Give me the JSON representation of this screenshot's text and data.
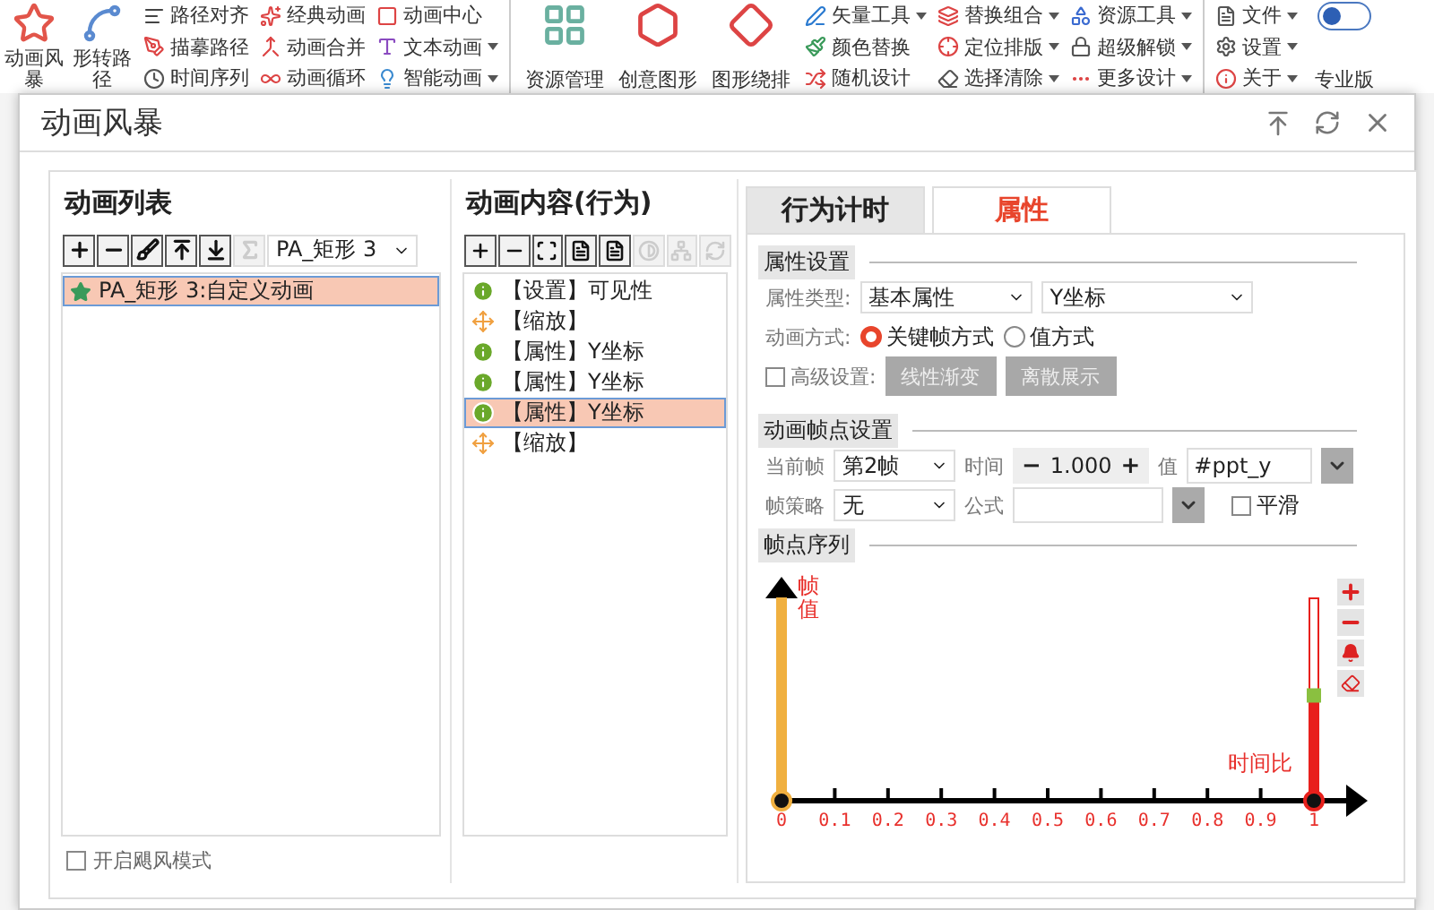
{
  "ribbon": {
    "groups": [
      {
        "items": [
          {
            "label": "动画风暴",
            "kind": "large"
          },
          {
            "label": "形转路径",
            "kind": "large"
          }
        ]
      },
      {
        "items": [
          {
            "label": "路径对齐",
            "kind": "small"
          },
          {
            "label": "描摹路径",
            "kind": "small"
          },
          {
            "label": "时间序列",
            "kind": "small"
          }
        ]
      },
      {
        "items": [
          {
            "label": "经典动画",
            "kind": "small"
          },
          {
            "label": "动画合并",
            "kind": "small"
          },
          {
            "label": "动画循环",
            "kind": "small"
          }
        ]
      },
      {
        "items": [
          {
            "label": "动画中心",
            "kind": "small"
          },
          {
            "label": "文本动画",
            "kind": "small",
            "dropdown": true
          },
          {
            "label": "智能动画",
            "kind": "small",
            "dropdown": true
          }
        ]
      },
      {
        "items": [
          {
            "label": "资源管理",
            "kind": "large"
          },
          {
            "label": "创意图形",
            "kind": "large"
          },
          {
            "label": "图形绕排",
            "kind": "large"
          }
        ]
      },
      {
        "items": [
          {
            "label": "矢量工具",
            "kind": "small",
            "dropdown": true
          },
          {
            "label": "颜色替换",
            "kind": "small"
          },
          {
            "label": "随机设计",
            "kind": "small"
          }
        ]
      },
      {
        "items": [
          {
            "label": "替换组合",
            "kind": "small",
            "dropdown": true
          },
          {
            "label": "定位排版",
            "kind": "small",
            "dropdown": true
          },
          {
            "label": "选择清除",
            "kind": "small",
            "dropdown": true
          }
        ]
      },
      {
        "items": [
          {
            "label": "资源工具",
            "kind": "small",
            "dropdown": true
          },
          {
            "label": "超级解锁",
            "kind": "small",
            "dropdown": true
          },
          {
            "label": "更多设计",
            "kind": "small",
            "dropdown": true
          }
        ]
      },
      {
        "items": [
          {
            "label": "文件",
            "kind": "small",
            "dropdown": true
          },
          {
            "label": "设置",
            "kind": "small",
            "dropdown": true
          },
          {
            "label": "关于",
            "kind": "small",
            "dropdown": true
          }
        ]
      },
      {
        "items": [
          {
            "label": "专业版",
            "kind": "toggle",
            "on": false
          }
        ]
      }
    ]
  },
  "dialog": {
    "title": "动画风暴"
  },
  "animation_list": {
    "heading": "动画列表",
    "toolbar": [
      {
        "disabled": false
      },
      {
        "disabled": false
      },
      {
        "disabled": false
      },
      {
        "disabled": false
      },
      {
        "disabled": false
      },
      {
        "disabled": true
      }
    ],
    "target": "PA_矩形 3",
    "items": [
      {
        "label": "PA_矩形 3:自定义动画",
        "selected": true
      }
    ],
    "storm_mode": {
      "label": "开启飓风模式",
      "checked": false
    }
  },
  "behaviors": {
    "heading": "动画内容(行为)",
    "toolbar": [
      {
        "disabled": false
      },
      {
        "disabled": false
      },
      {
        "disabled": false
      },
      {
        "disabled": false
      },
      {
        "disabled": false
      },
      {
        "disabled": true
      },
      {
        "disabled": true
      },
      {
        "disabled": true
      }
    ],
    "items": [
      {
        "kind": "info",
        "label": "【设置】可见性",
        "selected": false
      },
      {
        "kind": "scale",
        "label": "【缩放】",
        "selected": false
      },
      {
        "kind": "info",
        "label": "【属性】Y坐标",
        "selected": false
      },
      {
        "kind": "info",
        "label": "【属性】Y坐标",
        "selected": false
      },
      {
        "kind": "info",
        "label": "【属性】Y坐标",
        "selected": true
      },
      {
        "kind": "scale",
        "label": "【缩放】",
        "selected": false
      }
    ]
  },
  "tabs": [
    {
      "label": "行为计时",
      "selected": false
    },
    {
      "label": "属性",
      "selected": true
    }
  ],
  "properties": {
    "heading": "属性设置",
    "type_label": "属性类型:",
    "type_value": "基本属性",
    "property_value": "Y坐标",
    "mode_label": "动画方式:",
    "modes": [
      {
        "label": "关键帧方式",
        "selected": true
      },
      {
        "label": "值方式",
        "selected": false
      }
    ],
    "advanced": {
      "label": "高级设置:",
      "checked": false
    },
    "advanced_buttons": [
      {
        "label": "线性渐变",
        "disabled": true
      },
      {
        "label": "离散展示",
        "disabled": true
      }
    ]
  },
  "keyframe_settings": {
    "heading": "动画帧点设置",
    "current_label": "当前帧",
    "current_value": "第2帧",
    "time_label": "时间",
    "time_minus": "−",
    "time_value": "1.000",
    "time_plus": "+",
    "value_label": "值",
    "value": "#ppt_y",
    "strategy_label": "帧策略",
    "strategy_value": "无",
    "formula_label": "公式",
    "smooth": {
      "label": "平滑",
      "checked": false
    }
  },
  "sequence": {
    "heading": "帧点序列",
    "y_label": "帧值",
    "x_label": "时间比",
    "ticks": [
      "0",
      "0.1",
      "0.2",
      "0.3",
      "0.4",
      "0.5",
      "0.6",
      "0.7",
      "0.8",
      "0.9",
      "1"
    ],
    "keyframes": [
      {
        "kind": "start",
        "level": 1,
        "selected": false
      },
      {
        "kind": "end",
        "level": 0.52,
        "selected": true
      }
    ]
  }
}
